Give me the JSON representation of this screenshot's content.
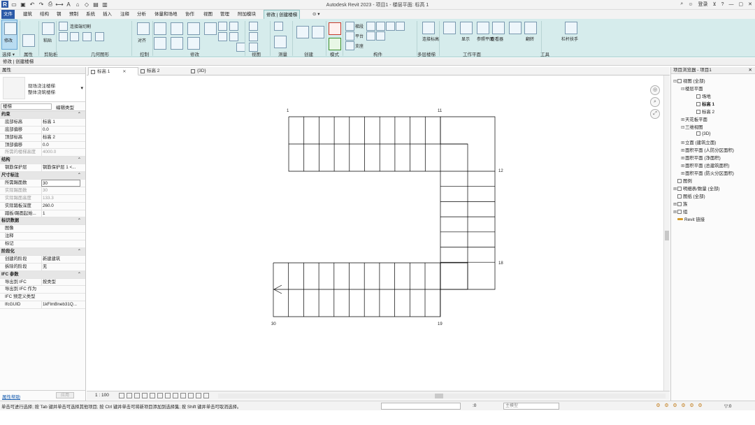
{
  "app": {
    "title": "Autodesk Revit 2023 - 项目1 - 楼层平面: 标高 1",
    "user": "登录"
  },
  "menu_tabs": [
    "文件",
    "建筑",
    "结构",
    "钢",
    "预制",
    "系统",
    "插入",
    "注释",
    "分析",
    "体量和场地",
    "协作",
    "视图",
    "管理",
    "附加模块",
    "修改 | 创建楼梯"
  ],
  "ribbon": {
    "select_label": "修改",
    "panels": [
      "选择 ▾",
      "属性",
      "剪贴板",
      "几何图形",
      "控制",
      "修改",
      "视图",
      "测量",
      "创建",
      "模式",
      "构件",
      "多层楼梯",
      "工作平面",
      "工具"
    ],
    "buttons": {
      "paste": "粘贴",
      "join": "连接端切割",
      "align": "对齐",
      "run": "梯段",
      "landing": "平台",
      "support": "支座",
      "connect_levels": "连接标高",
      "show": "显示",
      "ref_plane": "参照平面",
      "viewer": "查看器",
      "flip": "翻转",
      "railing": "栏杆扶手"
    }
  },
  "context_bar": "修改 | 创建楼梯",
  "properties": {
    "title": "属性",
    "type_line1": "现场浇注楼梯",
    "type_line2": "整体浇筑楼梯",
    "selector": "楼梯",
    "edit_type": "编辑类型",
    "rows": [
      {
        "kind": "group",
        "label": "约束"
      },
      {
        "kind": "row",
        "key": "底部标高",
        "value": "标高 1"
      },
      {
        "kind": "row",
        "key": "底部偏移",
        "value": "0.0"
      },
      {
        "kind": "row",
        "key": "顶部标高",
        "value": "标高 2"
      },
      {
        "kind": "row",
        "key": "顶部偏移",
        "value": "0.0"
      },
      {
        "kind": "gray",
        "key": "所需的楼梯高度",
        "value": "4000.0"
      },
      {
        "kind": "group",
        "label": "结构"
      },
      {
        "kind": "row",
        "key": "钢筋保护层",
        "value": "钢筋保护层 1 <..."
      },
      {
        "kind": "group",
        "label": "尺寸标注"
      },
      {
        "kind": "input",
        "key": "所需踢面数",
        "value": "30"
      },
      {
        "kind": "gray",
        "key": "实际踢面数",
        "value": "30"
      },
      {
        "kind": "gray",
        "key": "实际踢面高度",
        "value": "133.3"
      },
      {
        "kind": "row",
        "key": "实际踏板深度",
        "value": "260.0"
      },
      {
        "kind": "row",
        "key": "踏板/踢面起始...",
        "value": "1"
      },
      {
        "kind": "group",
        "label": "标识数据"
      },
      {
        "kind": "row",
        "key": "图像",
        "value": ""
      },
      {
        "kind": "row",
        "key": "注释",
        "value": ""
      },
      {
        "kind": "row",
        "key": "标记",
        "value": ""
      },
      {
        "kind": "group",
        "label": "阶段化"
      },
      {
        "kind": "row",
        "key": "创建的阶段",
        "value": "新建建筑"
      },
      {
        "kind": "row",
        "key": "拆除的阶段",
        "value": "无"
      },
      {
        "kind": "group",
        "label": "IFC 参数"
      },
      {
        "kind": "row",
        "key": "导出到 IFC",
        "value": "按类型"
      },
      {
        "kind": "row",
        "key": "导出到 IFC 作为",
        "value": ""
      },
      {
        "kind": "row",
        "key": "IFC 预定义类型",
        "value": ""
      },
      {
        "kind": "row",
        "key": "IfcGUID",
        "value": "1kFlmBneb31Q..."
      }
    ],
    "help_link": "属性帮助",
    "apply": "应用"
  },
  "view_tabs": [
    {
      "label": "标高 1",
      "active": true
    },
    {
      "label": "标高 2",
      "active": false
    },
    {
      "label": "{3D}",
      "active": false
    }
  ],
  "stair_labels": [
    "1",
    "11",
    "12",
    "18",
    "19",
    "30"
  ],
  "view_bar": {
    "scale": "1 : 100"
  },
  "browser": {
    "title": "项目浏览器 - 项目1",
    "items": [
      "视图 (全部)",
      "楼层平面",
      "场地",
      "标高 1",
      "标高 2",
      "天花板平面",
      "三维视图",
      "{3D}",
      "立面 (建筑立面)",
      "面积平面 (人防分区面积)",
      "面积平面 (净面积)",
      "面积平面 (总建筑面积)",
      "面积平面 (防火分区面积)",
      "图例",
      "明细表/数量 (全部)",
      "图纸 (全部)",
      "族",
      "组",
      "Revit 链接"
    ]
  },
  "status": {
    "message": "单击可进行选择; 按 Tab 键并单击可选择其他项目; 按 Ctrl 键并单击可将新项目添加到选择集; 按 Shift 键并单击可取消选择。",
    "zero": ":0",
    "model": "主模型",
    "filter_count": ":0"
  }
}
